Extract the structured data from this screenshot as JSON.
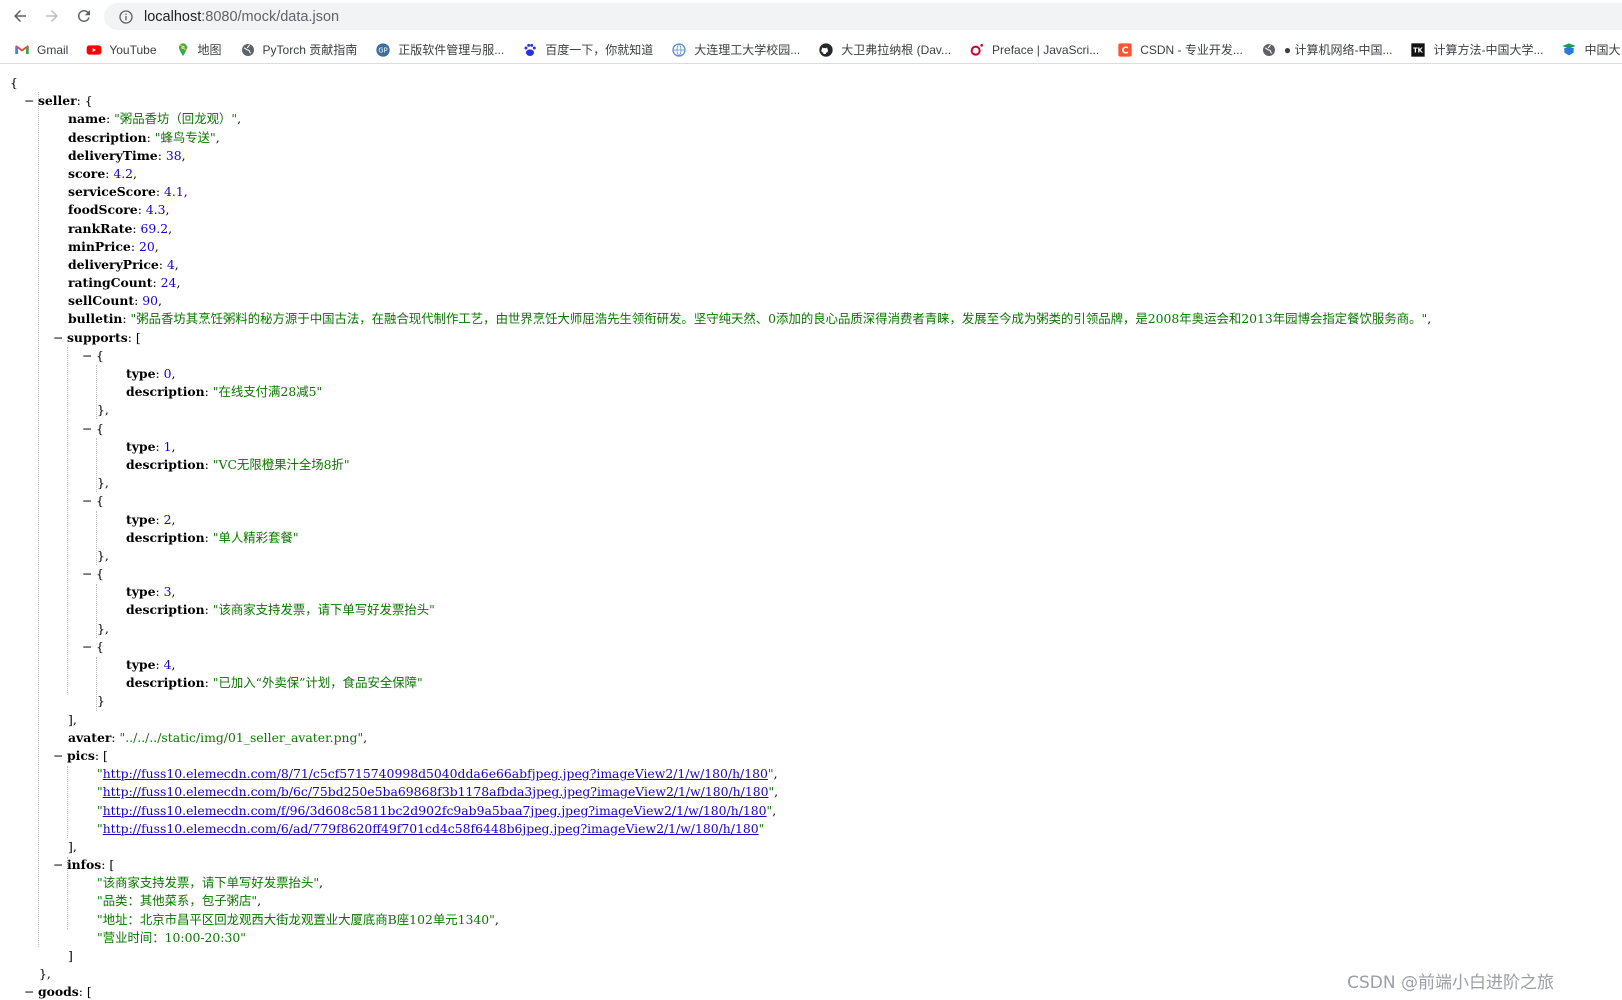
{
  "browser": {
    "url_host": "localhost",
    "url_rest": ":8080/mock/data.json",
    "bookmarks": [
      {
        "label": "Gmail",
        "icon": "gmail-icon"
      },
      {
        "label": "YouTube",
        "icon": "youtube-icon"
      },
      {
        "label": "地图",
        "icon": "maps-icon"
      },
      {
        "label": "PyTorch 贡献指南",
        "icon": "globe-icon"
      },
      {
        "label": "正版软件管理与服...",
        "icon": "software-icon"
      },
      {
        "label": "百度一下，你就知道",
        "icon": "baidu-icon"
      },
      {
        "label": "大连理工大学校园...",
        "icon": "campus-icon"
      },
      {
        "label": "大卫弗拉纳根 (Dav...",
        "icon": "github-icon"
      },
      {
        "label": "Preface | JavaScri...",
        "icon": "oreilly-icon"
      },
      {
        "label": "CSDN - 专业开发...",
        "icon": "csdn-icon"
      },
      {
        "label": "● 计算机网络-中国...",
        "icon": "globe-icon"
      },
      {
        "label": "计算方法-中国大学...",
        "icon": "tk-icon"
      },
      {
        "label": "中国大",
        "icon": "mooc-icon"
      }
    ]
  },
  "json": {
    "open_brace": "{",
    "seller_key": "seller",
    "seller": {
      "name": "\"粥品香坊（回龙观）\"",
      "description": "\"蜂鸟专送\"",
      "deliveryTime": "38",
      "score": "4.2",
      "serviceScore": "4.1",
      "foodScore": "4.3",
      "rankRate": "69.2",
      "minPrice": "20",
      "deliveryPrice": "4",
      "ratingCount": "24",
      "sellCount": "90",
      "bulletin": "\"粥品香坊其烹饪粥料的秘方源于中国古法，在融合现代制作工艺，由世界烹饪大师屈浩先生领衔研发。坚守纯天然、0添加的良心品质深得消费者青睐，发展至今成为粥类的引领品牌，是2008年奥运会和2013年园博会指定餐饮服务商。\"",
      "supports": [
        {
          "type": "0",
          "description": "\"在线支付满28减5\""
        },
        {
          "type": "1",
          "description": "\"VC无限橙果汁全场8折\""
        },
        {
          "type": "2",
          "description": "\"单人精彩套餐\""
        },
        {
          "type": "3",
          "description": "\"该商家支持发票，请下单写好发票抬头\""
        },
        {
          "type": "4",
          "description": "\"已加入“外卖保”计划，食品安全保障\""
        }
      ],
      "avater": "\"../../../static/img/01_seller_avater.png\"",
      "pics": [
        "http://fuss10.elemecdn.com/8/71/c5cf5715740998d5040dda6e66abfjpeg.jpeg?imageView2/1/w/180/h/180",
        "http://fuss10.elemecdn.com/b/6c/75bd250e5ba69868f3b1178afbda3jpeg.jpeg?imageView2/1/w/180/h/180",
        "http://fuss10.elemecdn.com/f/96/3d608c5811bc2d902fc9ab9a5baa7jpeg.jpeg?imageView2/1/w/180/h/180",
        "http://fuss10.elemecdn.com/6/ad/779f8620ff49f701cd4c58f6448b6jpeg.jpeg?imageView2/1/w/180/h/180"
      ],
      "infos": [
        "\"该商家支持发票，请下单写好发票抬头\"",
        "\"品类：其他菜系，包子粥店\"",
        "\"地址：北京市昌平区回龙观西大街龙观置业大厦底商B座102单元1340\"",
        "\"营业时间：10:00-20:30\""
      ]
    },
    "goods_key": "goods"
  },
  "watermark": "CSDN @前端小白进阶之旅",
  "colors": {
    "string": "#0b7500",
    "number": "#1a01cc",
    "omnibox_bg": "#f1f3f4"
  }
}
